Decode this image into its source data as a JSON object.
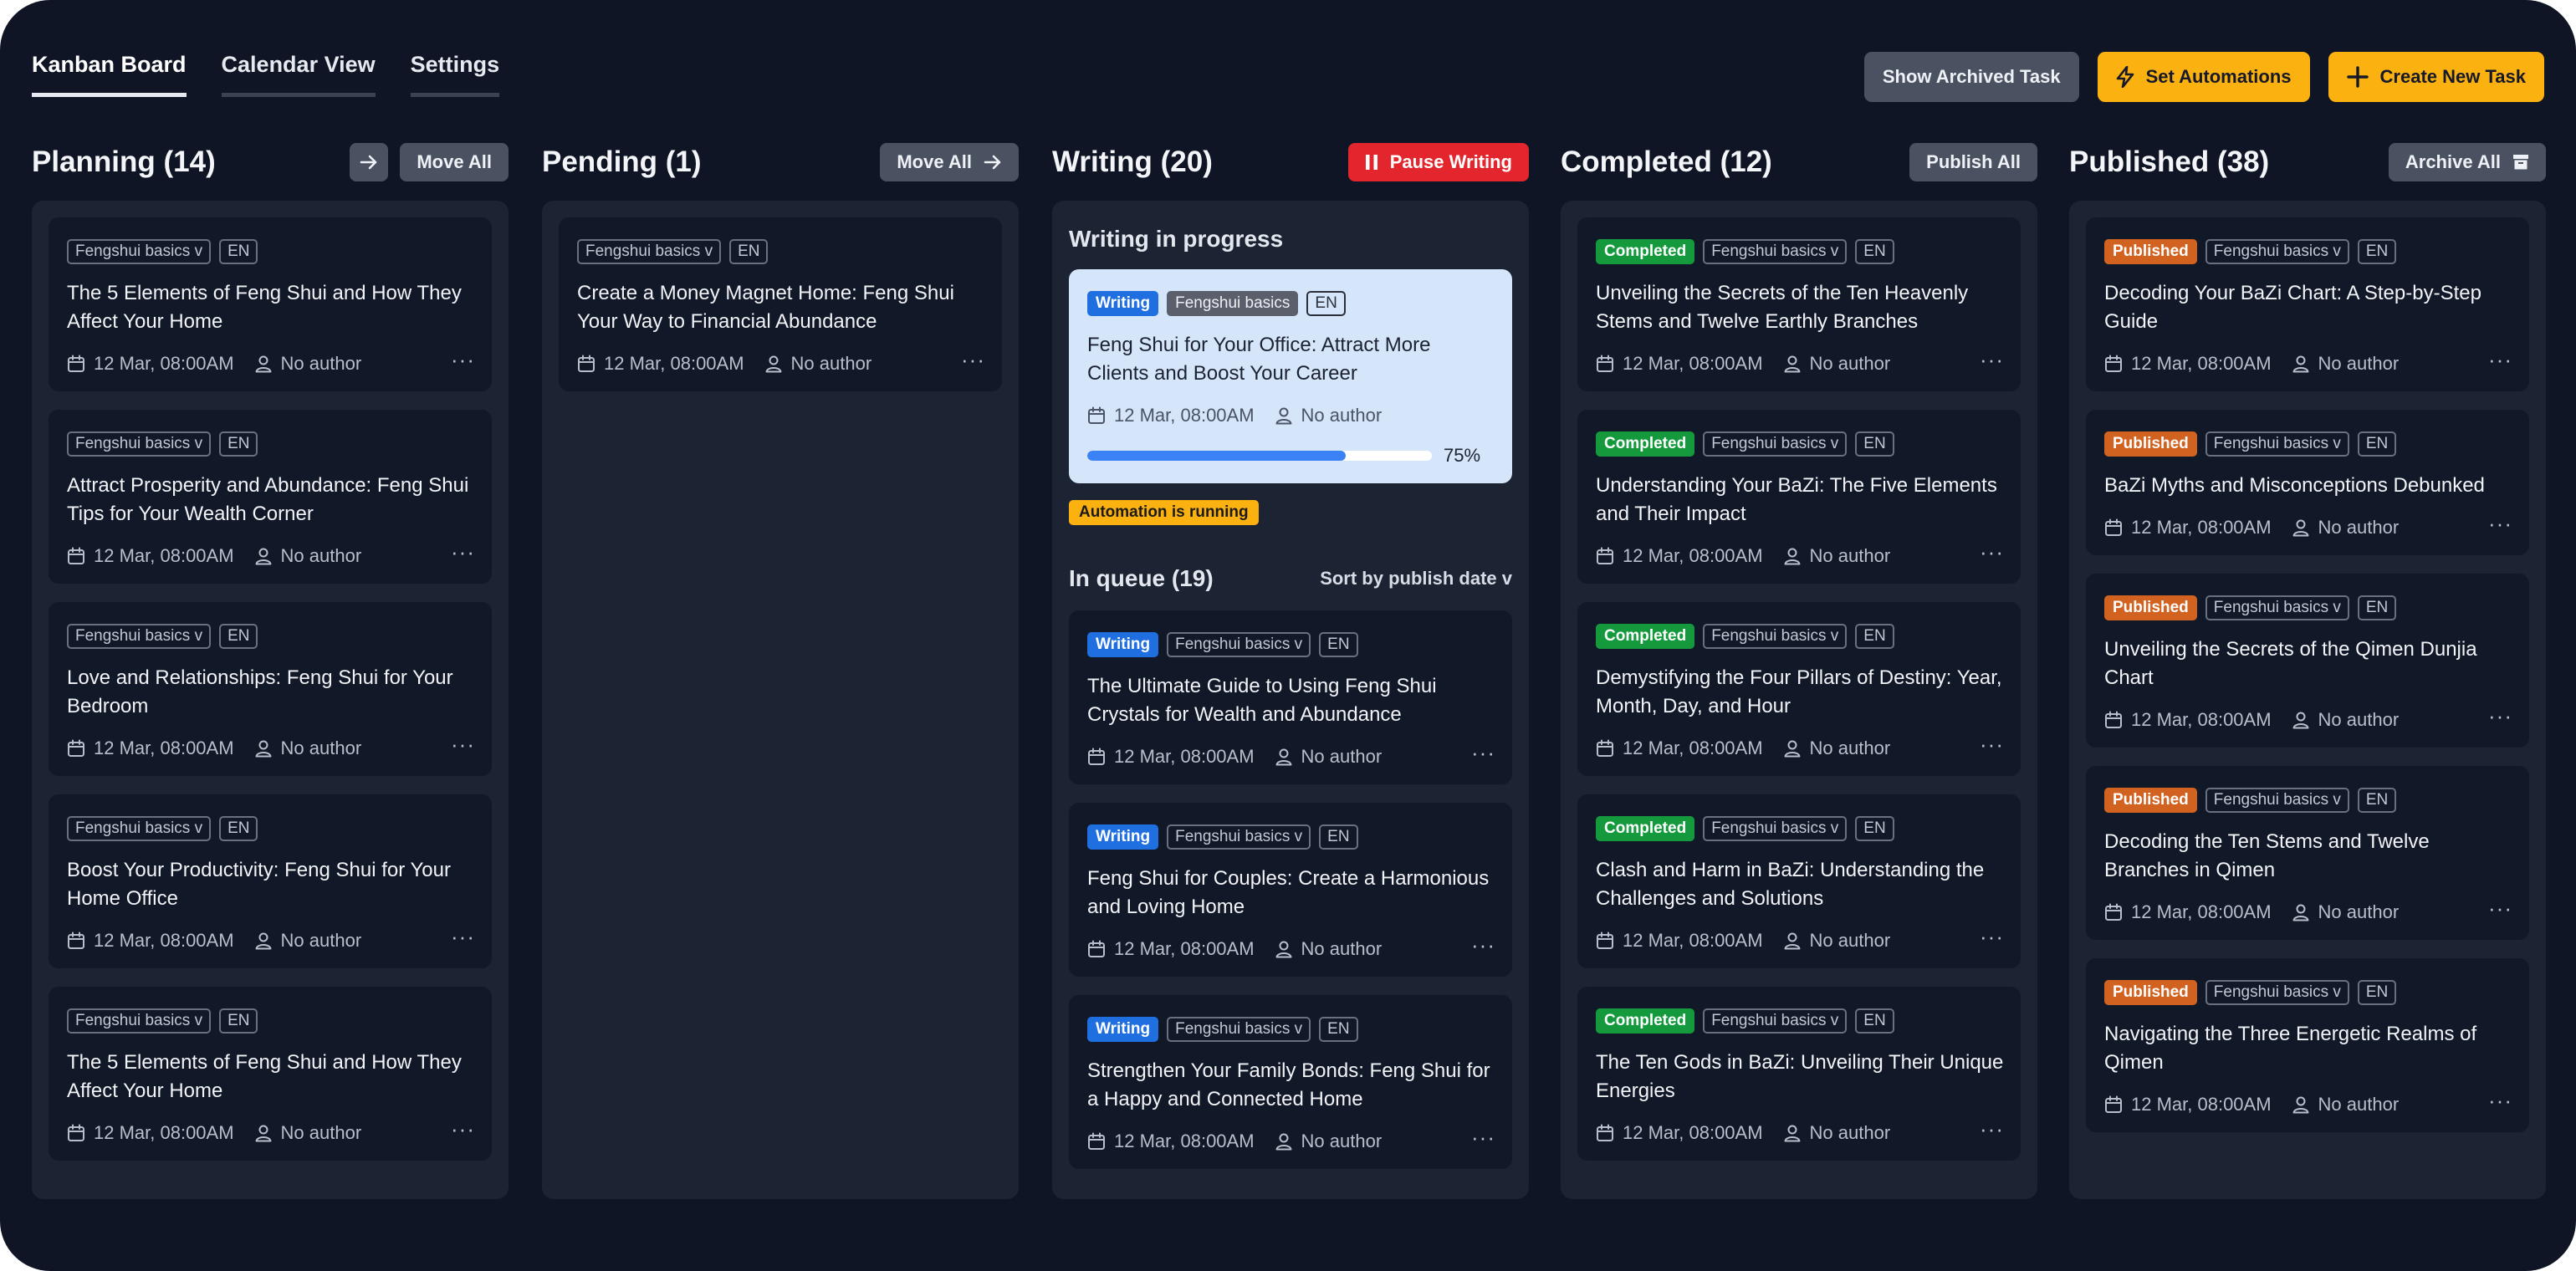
{
  "nav": {
    "tabs": [
      {
        "label": "Kanban Board"
      },
      {
        "label": "Calendar View"
      },
      {
        "label": "Settings"
      }
    ],
    "show_archived_label": "Show Archived Task",
    "set_automations_label": "Set Automations",
    "create_new_label": "Create New Task"
  },
  "columns": {
    "planning": {
      "title": "Planning (14)",
      "move_all": "Move All"
    },
    "pending": {
      "title": "Pending (1)",
      "move_all": "Move All"
    },
    "writing": {
      "title": "Writing (20)",
      "pause": "Pause Writing",
      "in_progress_label": "Writing in progress",
      "automation_badge": "Automation is running",
      "queue_label": "In queue (19)",
      "sort_label": "Sort by publish date v"
    },
    "completed": {
      "title": "Completed (12)",
      "publish_all": "Publish All"
    },
    "published": {
      "title": "Published (38)",
      "archive_all": "Archive All"
    }
  },
  "common": {
    "category": "Fengshui basics v",
    "category_plain": "Fengshui basics",
    "lang": "EN",
    "date": "12 Mar, 08:00AM",
    "author": "No author",
    "more": "···",
    "status_writing": "Writing",
    "status_completed": "Completed",
    "status_published": "Published"
  },
  "planning_cards": [
    {
      "title": "The 5 Elements of Feng Shui and How They Affect Your Home"
    },
    {
      "title": "Attract Prosperity and Abundance: Feng Shui Tips for Your Wealth Corner"
    },
    {
      "title": "Love and Relationships: Feng Shui for Your Bedroom"
    },
    {
      "title": "Boost Your Productivity: Feng Shui for Your Home Office"
    },
    {
      "title": "The 5 Elements of Feng Shui and How They Affect Your Home"
    }
  ],
  "pending_cards": [
    {
      "title": "Create a Money Magnet Home: Feng Shui Your Way to Financial Abundance"
    }
  ],
  "writing_active": {
    "title": "Feng Shui for Your Office: Attract More Clients and Boost Your Career",
    "progress": 75,
    "progress_text": "75%"
  },
  "writing_queue": [
    {
      "title": "The Ultimate Guide to Using Feng Shui Crystals for Wealth and Abundance"
    },
    {
      "title": "Feng Shui for Couples: Create a Harmonious and Loving Home"
    },
    {
      "title": "Strengthen Your Family Bonds: Feng Shui for a Happy and Connected Home"
    }
  ],
  "completed_cards": [
    {
      "title": "Unveiling the Secrets of the Ten Heavenly Stems and Twelve Earthly Branches"
    },
    {
      "title": "Understanding Your BaZi: The Five Elements and Their Impact"
    },
    {
      "title": "Demystifying the Four Pillars of Destiny: Year, Month, Day, and Hour"
    },
    {
      "title": "Clash and Harm in BaZi: Understanding the Challenges and Solutions"
    },
    {
      "title": "The Ten Gods in BaZi: Unveiling Their Unique Energies"
    }
  ],
  "published_cards": [
    {
      "title": "Decoding Your BaZi Chart: A Step-by-Step Guide"
    },
    {
      "title": "BaZi Myths and Misconceptions Debunked"
    },
    {
      "title": "Unveiling the Secrets of the Qimen Dunjia Chart"
    },
    {
      "title": "Decoding the Ten Stems and Twelve Branches in Qimen"
    },
    {
      "title": "Navigating the Three Energetic Realms of Qimen"
    }
  ],
  "colors": {
    "background": "#0f1524",
    "column": "#1c2333",
    "card": "#111827",
    "accent_yellow": "#fbb10f",
    "danger_red": "#e3262d",
    "writing_blue": "#1f6fe0",
    "completed_green": "#149a3d",
    "published_orange": "#d1621f"
  }
}
